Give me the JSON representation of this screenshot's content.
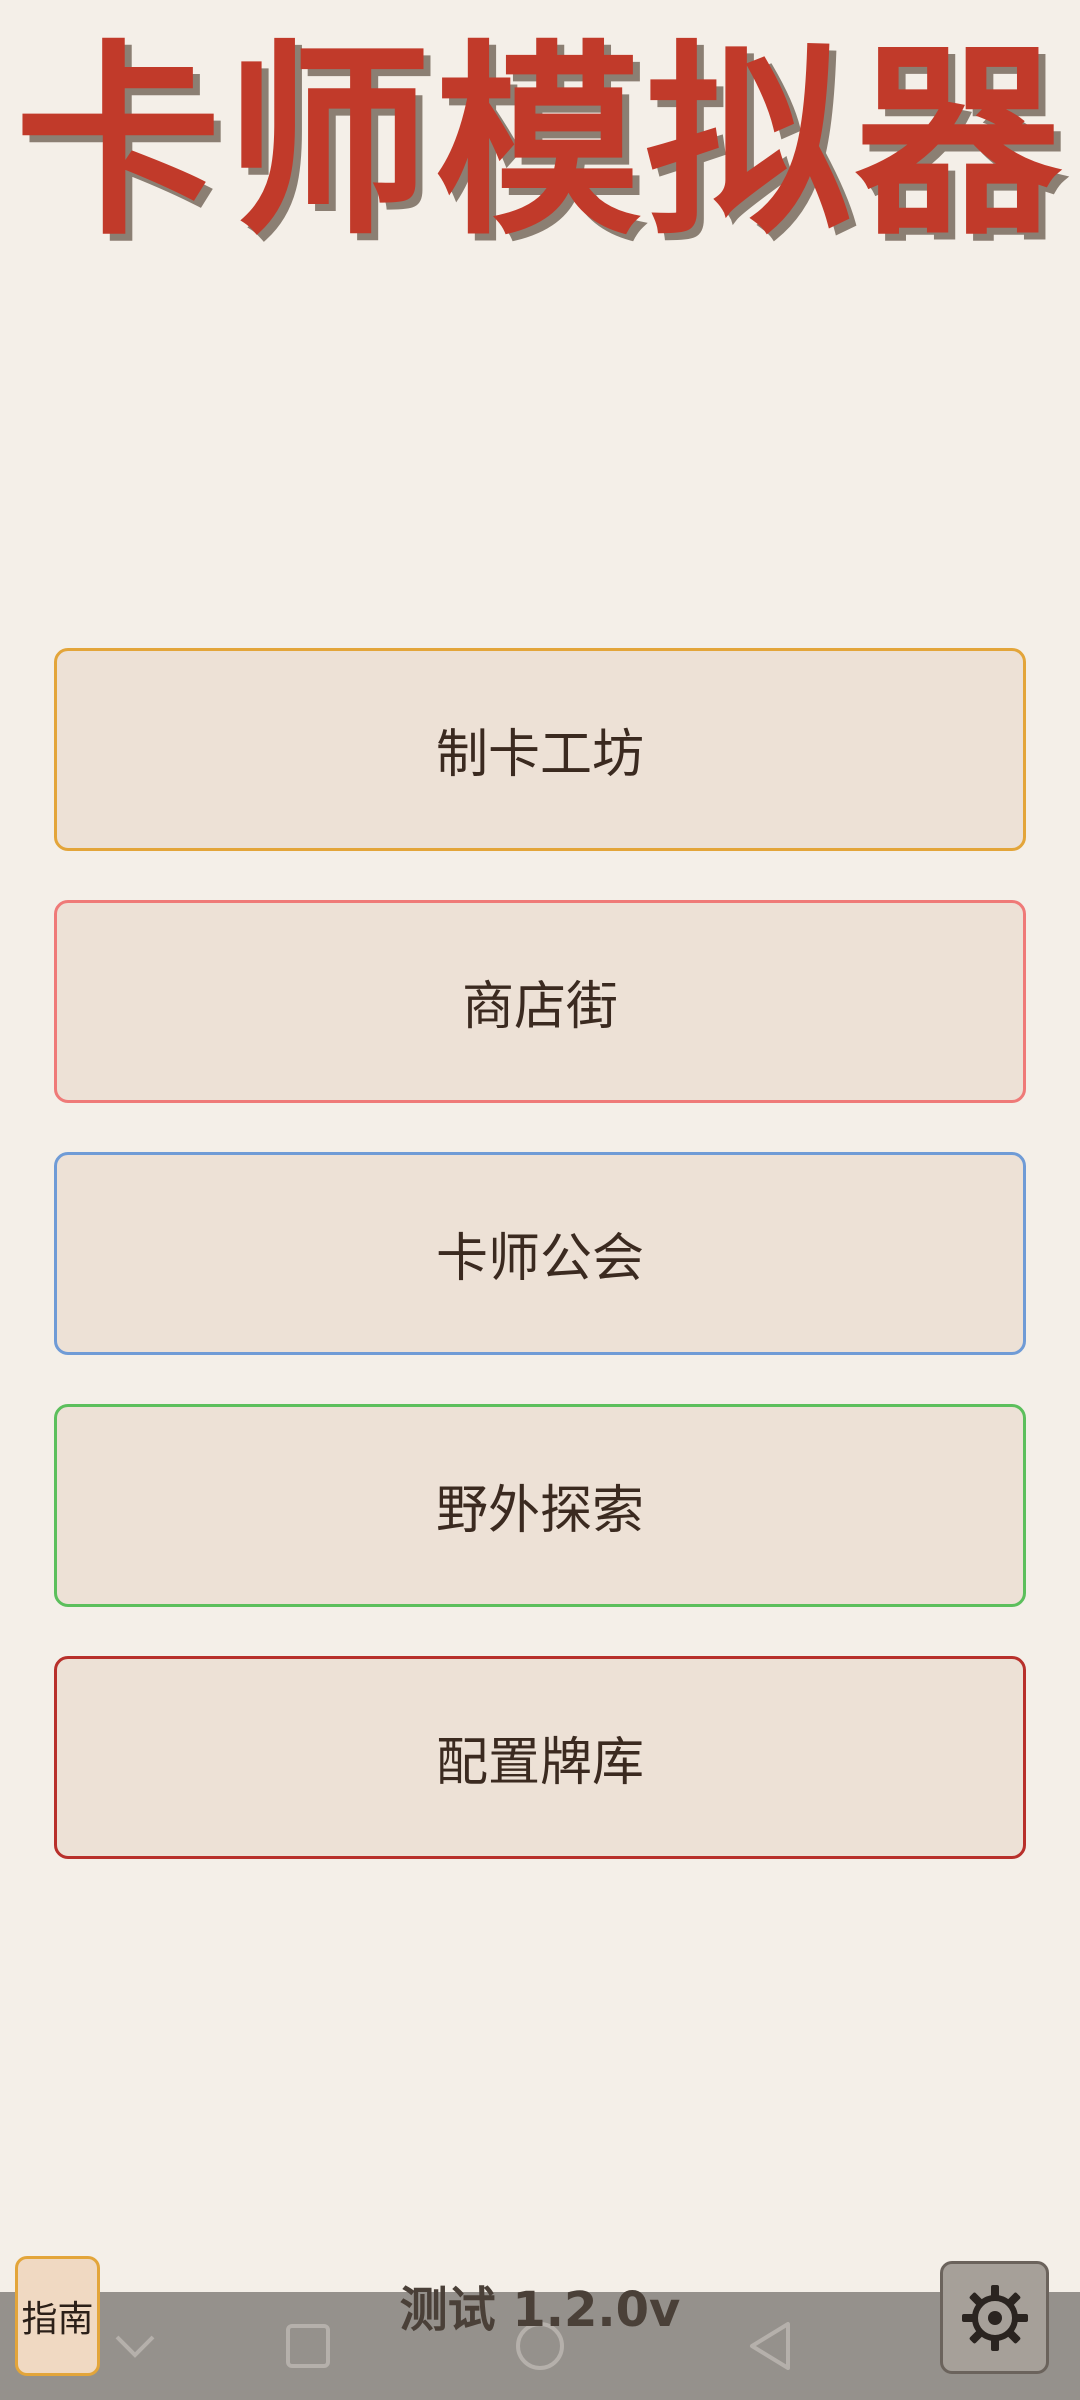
{
  "app": {
    "title": "卡师模拟器",
    "version": "测试 1.2.0v"
  },
  "menu": [
    {
      "id": "workshop",
      "label": "制卡工坊",
      "border": "#e3a53a"
    },
    {
      "id": "shop",
      "label": "商店街",
      "border": "#ef7a78"
    },
    {
      "id": "guild",
      "label": "卡师公会",
      "border": "#6f9bd6"
    },
    {
      "id": "explore",
      "label": "野外探索",
      "border": "#5cbf5c"
    },
    {
      "id": "deck",
      "label": "配置牌库",
      "border": "#b8302b"
    }
  ],
  "bottom": {
    "guide_label": "指南",
    "settings_icon": "gear-icon"
  },
  "navbar": {
    "icons": [
      "chevron-down-icon",
      "square-icon",
      "circle-icon",
      "triangle-back-icon"
    ]
  },
  "colors": {
    "background": "#f4efe8",
    "title": "#c13a2a",
    "button_fill": "#ede1d6",
    "text": "#3b2a20"
  }
}
